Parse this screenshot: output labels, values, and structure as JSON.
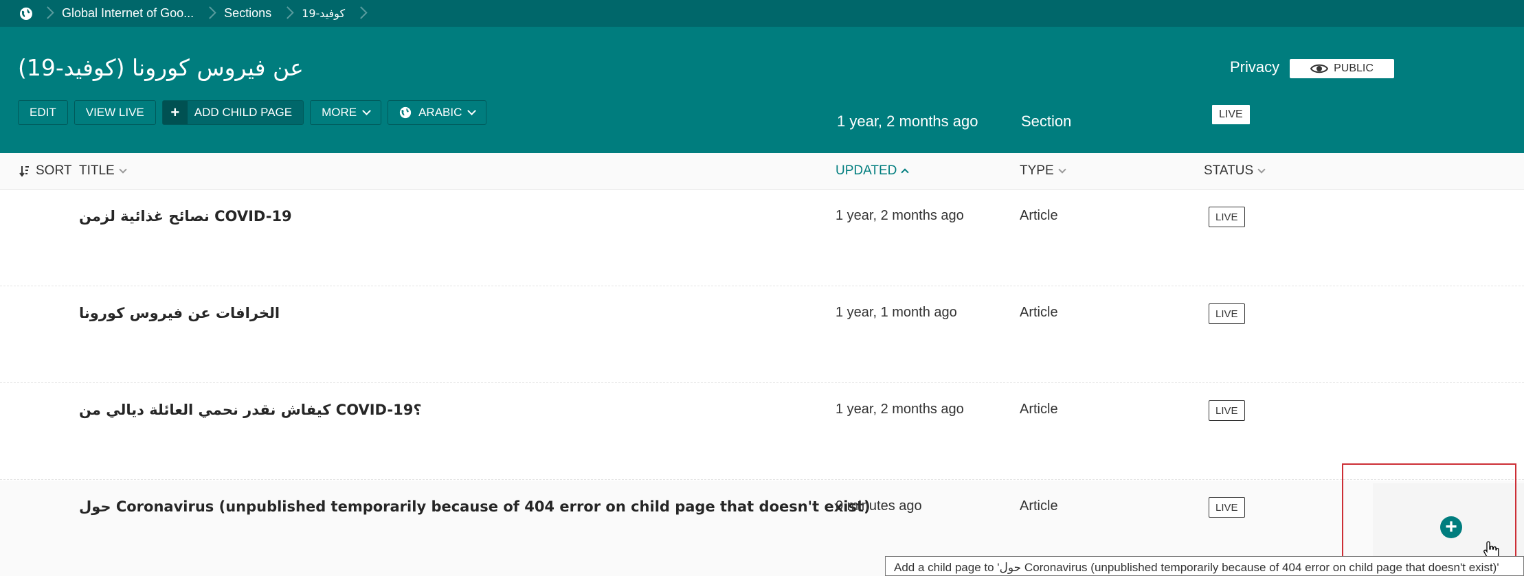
{
  "breadcrumb": {
    "items": [
      "Global Internet of Goo...",
      "Sections",
      "كوفيد-19"
    ]
  },
  "header": {
    "title": "عن فيروس كورونا (كوفيد-19)",
    "privacy_label": "Privacy",
    "privacy_status": "PUBLIC",
    "buttons": {
      "edit": "EDIT",
      "view_live": "VIEW LIVE",
      "add_child": "ADD CHILD PAGE",
      "more": "MORE",
      "language": "ARABIC"
    },
    "updated": "1 year, 2 months ago",
    "type": "Section",
    "status": "LIVE"
  },
  "columns": {
    "sort": "SORT",
    "title": "TITLE",
    "updated": "UPDATED",
    "type": "TYPE",
    "status": "STATUS"
  },
  "rows": [
    {
      "title": "نصائح غذائية لزمن COVID-19",
      "updated": "1 year, 2 months ago",
      "type": "Article",
      "status": "LIVE"
    },
    {
      "title": "الخرافات عن فيروس كورونا",
      "updated": "1 year, 1 month ago",
      "type": "Article",
      "status": "LIVE"
    },
    {
      "title": "كيفاش نقدر نحمي العائلة ديالي من COVID-19؟",
      "updated": "1 year, 2 months ago",
      "type": "Article",
      "status": "LIVE"
    },
    {
      "title": "حول Coronavirus (unpublished temporarily because of 404 error on child page that doesn't exist)",
      "updated": "0 minutes ago",
      "type": "Article",
      "status": "LIVE"
    }
  ],
  "tooltip": "Add a child page to 'حول Coronavirus (unpublished temporarily because of 404 error on child page that doesn't exist)'",
  "colors": {
    "header_bg": "#007d7e",
    "breadcrumb_bg": "#00676a",
    "accent": "#007d7e",
    "highlight": "#cd2e35"
  }
}
